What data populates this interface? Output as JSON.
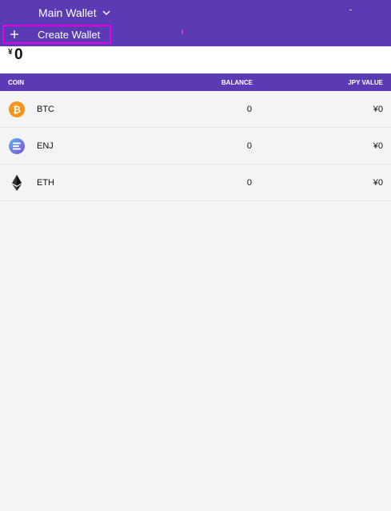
{
  "header": {
    "wallet_name": "Main Wallet",
    "create_wallet_label": "Create Wallet"
  },
  "summary": {
    "currency_symbol": "¥",
    "total": "0"
  },
  "table": {
    "columns": [
      "COIN",
      "BALANCE",
      "JPY VALUE"
    ],
    "rows": [
      {
        "symbol": "BTC",
        "balance": "0",
        "value": "¥0",
        "icon": "bitcoin-icon"
      },
      {
        "symbol": "ENJ",
        "balance": "0",
        "value": "¥0",
        "icon": "enjin-icon"
      },
      {
        "symbol": "ETH",
        "balance": "0",
        "value": "¥0",
        "icon": "ethereum-icon"
      }
    ]
  },
  "colors": {
    "header": "#5a3bb4",
    "highlight": "#e200e5",
    "btc": "#f7931a",
    "enj": "#7866d5"
  }
}
